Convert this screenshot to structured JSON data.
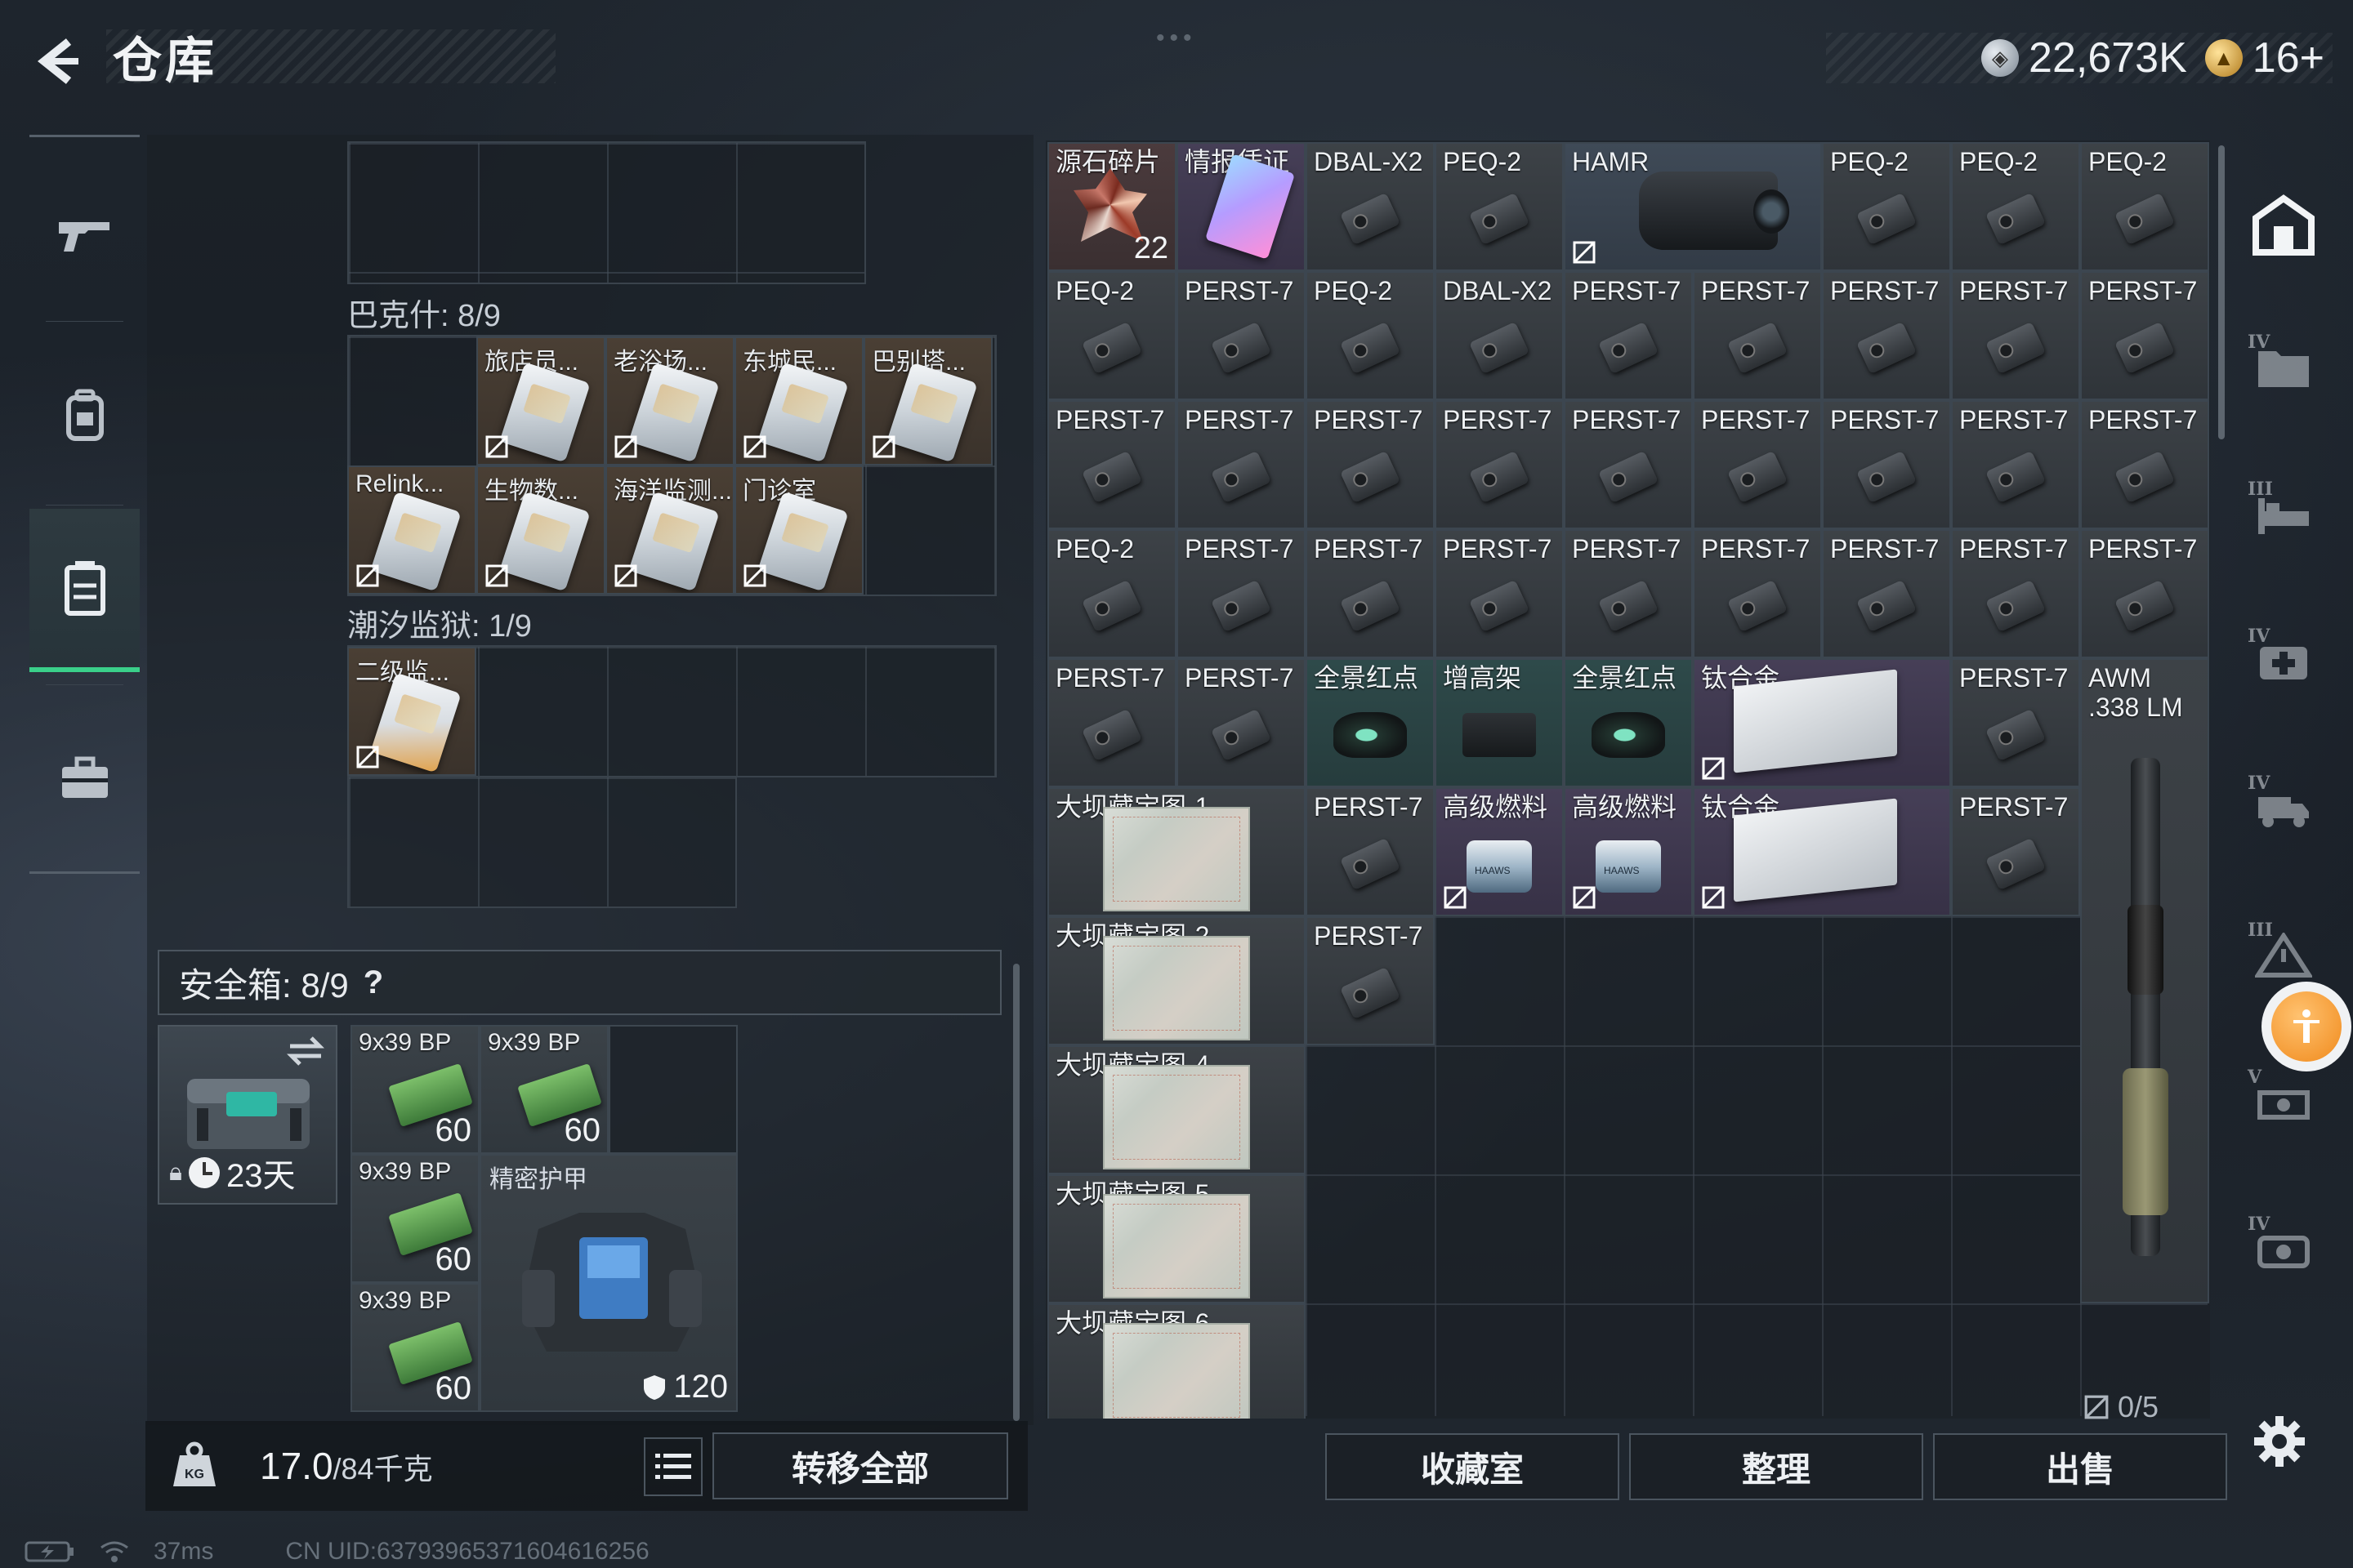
{
  "header": {
    "title": "仓库",
    "currency_silver": "22,673K",
    "currency_gold": "16+"
  },
  "left_rail": {
    "items": [
      {
        "icon": "gun-icon"
      },
      {
        "icon": "backpack-icon"
      },
      {
        "icon": "container-icon",
        "active": true
      },
      {
        "icon": "briefcase-icon"
      }
    ]
  },
  "containers": {
    "backpack_label": "巴克什: 8/9",
    "backpack_items": [
      "旅店员...",
      "老浴场...",
      "东城民...",
      "巴别塔...",
      "Relink...",
      "生物数...",
      "海洋监测...",
      "门诊室"
    ],
    "prison_label": "潮汐监狱: 1/9",
    "prison_items": [
      "二级监..."
    ],
    "cut_top_label": "..."
  },
  "safebox": {
    "label": "安全箱: 8/9",
    "help": "?",
    "days": "23天",
    "ammo": [
      {
        "name": "9x39 BP",
        "count": "60"
      },
      {
        "name": "9x39 BP",
        "count": "60"
      },
      {
        "name": "9x39 BP",
        "count": "60"
      },
      {
        "name": "9x39 BP",
        "count": "60"
      }
    ],
    "armor_name": "精密护甲",
    "armor_durability": "120"
  },
  "weight": {
    "value": "17.0",
    "capacity": "/84千克"
  },
  "buttons": {
    "transfer_all": "转移全部",
    "collection": "收藏室",
    "organize": "整理",
    "sell": "出售"
  },
  "stash": {
    "r1": [
      "源石碎片",
      "情报凭证",
      "DBAL-X2",
      "PEQ-2",
      "HAMR",
      "PEQ-2",
      "PEQ-2",
      "PEQ-2"
    ],
    "r1_shard_count": "22",
    "r2": [
      "PEQ-2",
      "PERST-7",
      "PEQ-2",
      "DBAL-X2",
      "PERST-7",
      "PERST-7",
      "PERST-7",
      "PERST-7",
      "PERST-7"
    ],
    "r3": [
      "PERST-7",
      "PERST-7",
      "PERST-7",
      "PERST-7",
      "PERST-7",
      "PERST-7",
      "PERST-7",
      "PERST-7",
      "PERST-7"
    ],
    "r4": [
      "PEQ-2",
      "PERST-7",
      "PERST-7",
      "PERST-7",
      "PERST-7",
      "PERST-7",
      "PERST-7",
      "PERST-7",
      "PERST-7"
    ],
    "r5": [
      "PERST-7",
      "PERST-7",
      "全景红点",
      "增高架",
      "全景红点",
      "钛合金",
      "PERST-7",
      "AWM .338 LM"
    ],
    "r6": [
      "大坝藏宝图-1",
      "PERST-7",
      "高级燃料",
      "高级燃料",
      "钛合金",
      "PERST-7"
    ],
    "r7": [
      "大坝藏宝图-2",
      "PERST-7"
    ],
    "r8": [
      "大坝藏宝图-4"
    ],
    "r9": [
      "大坝藏宝图-5"
    ],
    "r10": [
      "大坝藏宝图-6"
    ],
    "count": "0/5"
  },
  "status": {
    "ping": "37ms",
    "uid": "CN UID:6379396537160461625​6"
  },
  "colors": {
    "accent_green": "#3ad08a",
    "fab_orange": "#f08a1c"
  }
}
